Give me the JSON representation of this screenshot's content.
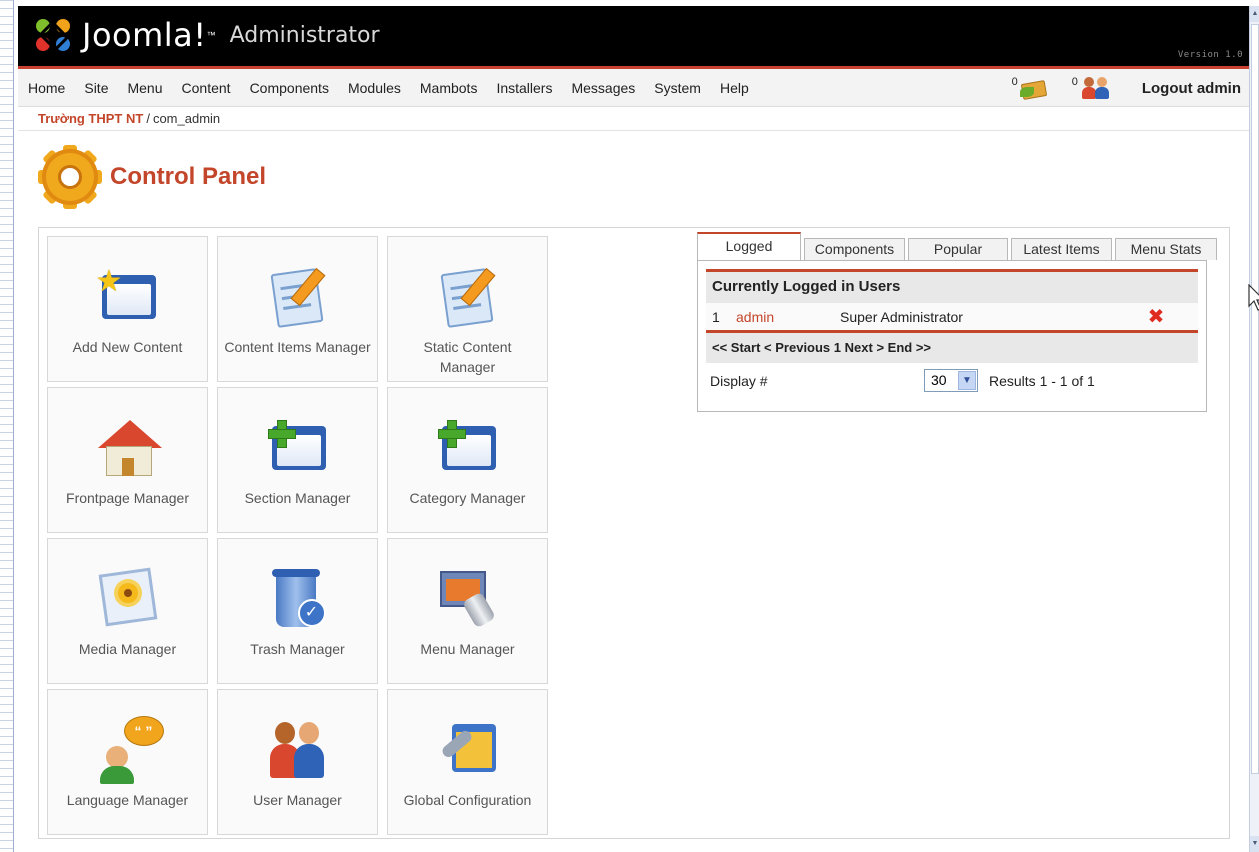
{
  "header": {
    "brand": "Joomla!",
    "trademark": "™",
    "subtitle": "Administrator",
    "version": "Version 1.0"
  },
  "menu": {
    "items": [
      "Home",
      "Site",
      "Menu",
      "Content",
      "Components",
      "Modules",
      "Mambots",
      "Installers",
      "Messages",
      "System",
      "Help"
    ],
    "messages_count": "0",
    "users_count": "0",
    "logout_label": "Logout admin"
  },
  "breadcrumb": {
    "home": "Trường THPT NT",
    "separator": "/",
    "current": "com_admin"
  },
  "page": {
    "title": "Control Panel"
  },
  "tiles": [
    {
      "label": "Add New Content",
      "icon": "add-content-icon"
    },
    {
      "label": "Content Items Manager",
      "icon": "content-items-icon"
    },
    {
      "label": "Static Content Manager",
      "icon": "static-content-icon"
    },
    {
      "label": "Frontpage Manager",
      "icon": "frontpage-icon"
    },
    {
      "label": "Section Manager",
      "icon": "section-icon"
    },
    {
      "label": "Category Manager",
      "icon": "category-icon"
    },
    {
      "label": "Media Manager",
      "icon": "media-icon"
    },
    {
      "label": "Trash Manager",
      "icon": "trash-icon"
    },
    {
      "label": "Menu Manager",
      "icon": "menu-manager-icon"
    },
    {
      "label": "Language Manager",
      "icon": "language-icon"
    },
    {
      "label": "User Manager",
      "icon": "user-manager-icon"
    },
    {
      "label": "Global Configuration",
      "icon": "global-config-icon"
    }
  ],
  "panel": {
    "tabs": [
      "Logged",
      "Components",
      "Popular",
      "Latest Items",
      "Menu Stats"
    ],
    "active_tab": "Logged",
    "table_title": "Currently Logged in Users",
    "rows": [
      {
        "index": "1",
        "username": "admin",
        "role": "Super Administrator"
      }
    ],
    "pager": {
      "start": "<< Start",
      "previous": "< Previous",
      "page": "1",
      "next": "Next >",
      "end": "End >>"
    },
    "display_label": "Display #",
    "display_value": "30",
    "results": "Results 1 - 1 of 1"
  },
  "colors": {
    "accent": "#c3462b",
    "header_bg": "#000000",
    "menubar_bg": "#f3f3f3"
  }
}
